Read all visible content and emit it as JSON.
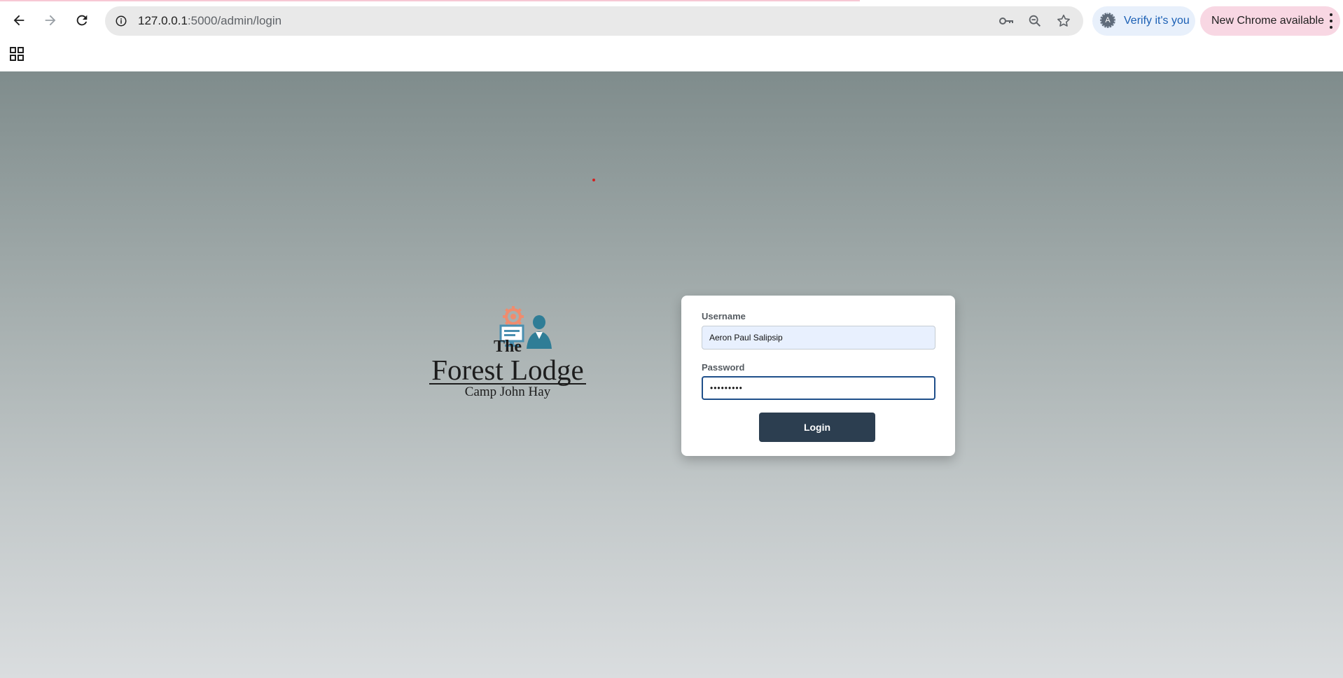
{
  "browser": {
    "url_host": "127.0.0.1",
    "url_path": ":5000/admin/login",
    "verify_label": "Verify it's you",
    "verify_avatar_letter": "A",
    "update_label": "New Chrome available",
    "icons": [
      "back-arrow-icon",
      "forward-arrow-icon",
      "reload-icon",
      "site-info-icon",
      "password-key-icon",
      "zoom-icon",
      "bookmark-star-icon",
      "apps-grid-icon",
      "more-vert-icon"
    ]
  },
  "logo": {
    "line1": "The",
    "line2": "Forest Lodge",
    "line3": "Camp John Hay",
    "colors": {
      "gear": "#f08c6e",
      "figure": "#2f7d96",
      "monitor": "#4a8fb0"
    }
  },
  "login_form": {
    "username_label": "Username",
    "username_value": "Aeron Paul Salipsip",
    "password_label": "Password",
    "password_value": "•••••••••",
    "submit_label": "Login"
  },
  "colors": {
    "button_bg": "#2c3e50",
    "password_focus_border": "#1f4f8a",
    "autofill_bg": "#e8f0fe"
  }
}
